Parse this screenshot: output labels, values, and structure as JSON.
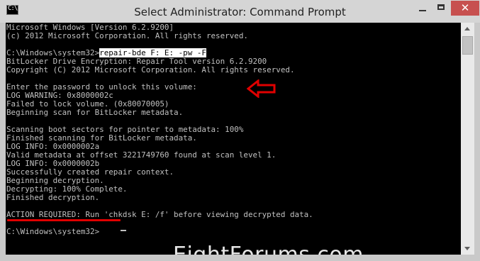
{
  "window": {
    "title": "Select Administrator: Command Prompt",
    "icon_text": "C:\\",
    "close_glyph": "✕"
  },
  "console": {
    "lines": [
      "Microsoft Windows [Version 6.2.9200]",
      "(c) 2012 Microsoft Corporation. All rights reserved.",
      "",
      "",
      "BitLocker Drive Encryption: Repair Tool version 6.2.9200",
      "Copyright (C) 2012 Microsoft Corporation. All rights reserved.",
      "",
      "Enter the password to unlock this volume:",
      "LOG WARNING: 0x8000002c",
      "Failed to lock volume. (0x80070005)",
      "Beginning scan for BitLocker metadata.",
      "",
      "Scanning boot sectors for pointer to metadata: 100%",
      "Finished scanning for BitLocker metadata.",
      "LOG INFO: 0x0000002a",
      "Valid metadata at offset 3221749760 found at scan level 1.",
      "LOG INFO: 0x0000002b",
      "Successfully created repair context.",
      "Beginning decryption.",
      "Decrypting: 100% Complete.",
      "Finished decryption.",
      "",
      "ACTION REQUIRED: Run 'chkdsk E: /f' before viewing decrypted data.",
      "",
      "C:\\Windows\\system32>"
    ],
    "command_prompt": "C:\\Windows\\system32>",
    "selected_command": "repair-bde F: E: -pw -F"
  },
  "watermark": "EightForums.com",
  "annotation_color": "#e00000",
  "colors": {
    "console_bg": "#000000",
    "console_text": "#c0c0c0",
    "close_button": "#c7504f"
  }
}
